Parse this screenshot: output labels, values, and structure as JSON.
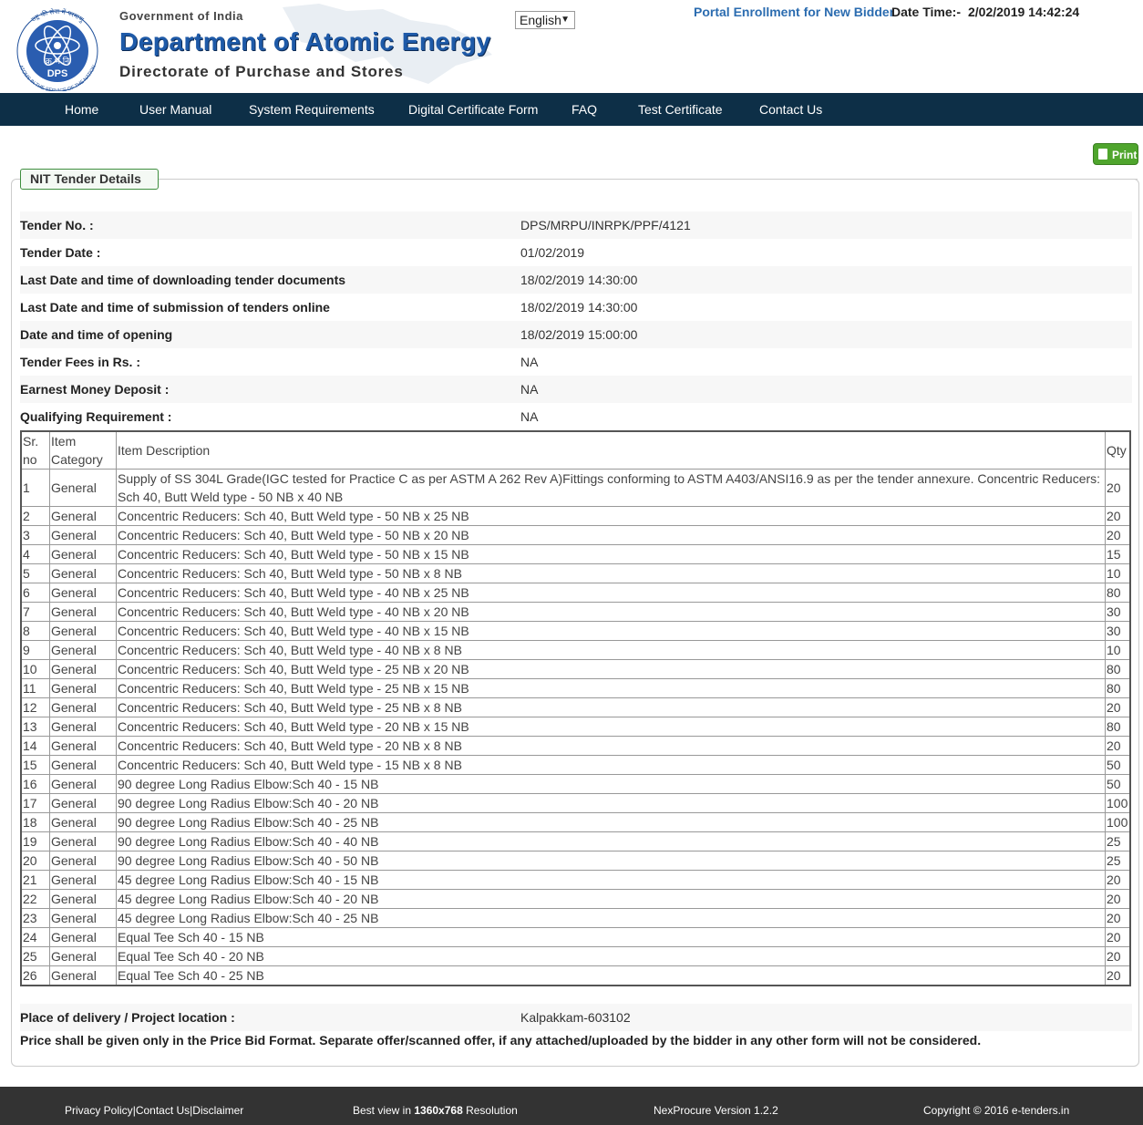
{
  "header": {
    "logo_text": "DPS",
    "logo_motto": "ATOMS IN THE SERVICE OF THE NATION",
    "logo_hindi_top": "राष्ट्र की सेवा में परमाणु",
    "logo_hindi_mid": "क्र भं नि",
    "gov": "Government of India",
    "dept": "Department of Atomic Energy",
    "directorate": "Directorate of Purchase and Stores",
    "language": "English",
    "enroll": "Portal Enrollment for New Bidder",
    "datetime_label": "Date Time:-",
    "datetime_value": "2/02/2019 14:42:24"
  },
  "nav": [
    "Home",
    "User Manual",
    "System Requirements",
    "Digital Certificate Form",
    "FAQ",
    "Test Certificate",
    "Contact Us"
  ],
  "print_label": "Print",
  "section_title": "NIT Tender Details",
  "details": [
    {
      "label": "Tender No. :",
      "value": "DPS/MRPU/INRPK/PPF/4121"
    },
    {
      "label": "Tender Date :",
      "value": "01/02/2019"
    },
    {
      "label": "Last Date and time of downloading tender documents",
      "value": "18/02/2019 14:30:00"
    },
    {
      "label": "Last Date and time of submission of tenders online",
      "value": "18/02/2019 14:30:00"
    },
    {
      "label": "Date and time of opening",
      "value": "18/02/2019 15:00:00"
    },
    {
      "label": "Tender Fees in Rs. :",
      "value": "NA"
    },
    {
      "label": "Earnest Money Deposit :",
      "value": "NA"
    },
    {
      "label": "Qualifying Requirement :",
      "value": "NA"
    }
  ],
  "items_header": {
    "sr": "Sr. no",
    "category": "Item Category",
    "description": "Item Description",
    "qty": "Qty"
  },
  "items": [
    {
      "sr": "1",
      "category": "General",
      "description": "Supply of SS 304L Grade(IGC tested for Practice C as per ASTM A 262 Rev A)Fittings conforming to ASTM A403/ANSI16.9 as per the tender annexure. Concentric Reducers: Sch 40, Butt Weld type - 50 NB x 40 NB",
      "qty": "20"
    },
    {
      "sr": "2",
      "category": "General",
      "description": "Concentric Reducers: Sch 40, Butt Weld type - 50 NB x 25 NB",
      "qty": "20"
    },
    {
      "sr": "3",
      "category": "General",
      "description": "Concentric Reducers: Sch 40, Butt Weld type - 50 NB x 20 NB",
      "qty": "20"
    },
    {
      "sr": "4",
      "category": "General",
      "description": "Concentric Reducers: Sch 40, Butt Weld type - 50 NB x 15 NB",
      "qty": "15"
    },
    {
      "sr": "5",
      "category": "General",
      "description": "Concentric Reducers: Sch 40, Butt Weld type - 50 NB x 8 NB",
      "qty": "10"
    },
    {
      "sr": "6",
      "category": "General",
      "description": "Concentric Reducers: Sch 40, Butt Weld type - 40 NB x 25 NB",
      "qty": "80"
    },
    {
      "sr": "7",
      "category": "General",
      "description": "Concentric Reducers: Sch 40, Butt Weld type - 40 NB x 20 NB",
      "qty": "30"
    },
    {
      "sr": "8",
      "category": "General",
      "description": "Concentric Reducers: Sch 40, Butt Weld type - 40 NB x 15 NB",
      "qty": "30"
    },
    {
      "sr": "9",
      "category": "General",
      "description": "Concentric Reducers: Sch 40, Butt Weld type - 40 NB x 8 NB",
      "qty": "10"
    },
    {
      "sr": "10",
      "category": "General",
      "description": "Concentric Reducers: Sch 40, Butt Weld type - 25 NB x 20 NB",
      "qty": "80"
    },
    {
      "sr": "11",
      "category": "General",
      "description": "Concentric Reducers: Sch 40, Butt Weld type - 25 NB x 15 NB",
      "qty": "80"
    },
    {
      "sr": "12",
      "category": "General",
      "description": "Concentric Reducers: Sch 40, Butt Weld type - 25 NB x 8 NB",
      "qty": "20"
    },
    {
      "sr": "13",
      "category": "General",
      "description": "Concentric Reducers: Sch 40, Butt Weld type - 20 NB x 15 NB",
      "qty": "80"
    },
    {
      "sr": "14",
      "category": "General",
      "description": "Concentric Reducers: Sch 40, Butt Weld type - 20 NB x 8 NB",
      "qty": "20"
    },
    {
      "sr": "15",
      "category": "General",
      "description": "Concentric Reducers: Sch 40, Butt Weld type - 15 NB x 8 NB",
      "qty": "50"
    },
    {
      "sr": "16",
      "category": "General",
      "description": "90 degree Long Radius Elbow:Sch 40 - 15 NB",
      "qty": "50"
    },
    {
      "sr": "17",
      "category": "General",
      "description": "90 degree Long Radius Elbow:Sch 40 - 20 NB",
      "qty": "100"
    },
    {
      "sr": "18",
      "category": "General",
      "description": "90 degree Long Radius Elbow:Sch 40 - 25 NB",
      "qty": "100"
    },
    {
      "sr": "19",
      "category": "General",
      "description": "90 degree Long Radius Elbow:Sch 40 - 40 NB",
      "qty": "25"
    },
    {
      "sr": "20",
      "category": "General",
      "description": "90 degree Long Radius Elbow:Sch 40 - 50 NB",
      "qty": "25"
    },
    {
      "sr": "21",
      "category": "General",
      "description": "45 degree Long Radius Elbow:Sch 40 - 15 NB",
      "qty": "20"
    },
    {
      "sr": "22",
      "category": "General",
      "description": "45 degree Long Radius Elbow:Sch 40 - 20 NB",
      "qty": "20"
    },
    {
      "sr": "23",
      "category": "General",
      "description": "45 degree Long Radius Elbow:Sch 40 - 25 NB",
      "qty": "20"
    },
    {
      "sr": "24",
      "category": "General",
      "description": "Equal Tee Sch 40 - 15 NB",
      "qty": "20"
    },
    {
      "sr": "25",
      "category": "General",
      "description": "Equal Tee Sch 40 - 20 NB",
      "qty": "20"
    },
    {
      "sr": "26",
      "category": "General",
      "description": "Equal Tee Sch 40 - 25 NB",
      "qty": "20"
    }
  ],
  "delivery": {
    "label": "Place of delivery / Project location :",
    "value": "Kalpakkam-603102"
  },
  "note": "Price shall be given only in the Price Bid Format. Separate offer/scanned offer, if any attached/uploaded by the bidder in any other form will not be considered.",
  "footer": {
    "privacy": "Privacy Policy",
    "contact": "Contact Us",
    "disclaimer": "Disclaimer",
    "sep": "|",
    "bestview_pre": "Best view in ",
    "bestview_res": "1360x768",
    "bestview_post": " Resolution",
    "version": "NexProcure Version 1.2.2",
    "copyright": "Copyright © 2016 e-tenders.in"
  },
  "colors": {
    "nav_bg": "#0d2f47",
    "footer_bg": "#333333",
    "brand_blue": "#1e5aa8",
    "print_green": "#4fa52d"
  }
}
